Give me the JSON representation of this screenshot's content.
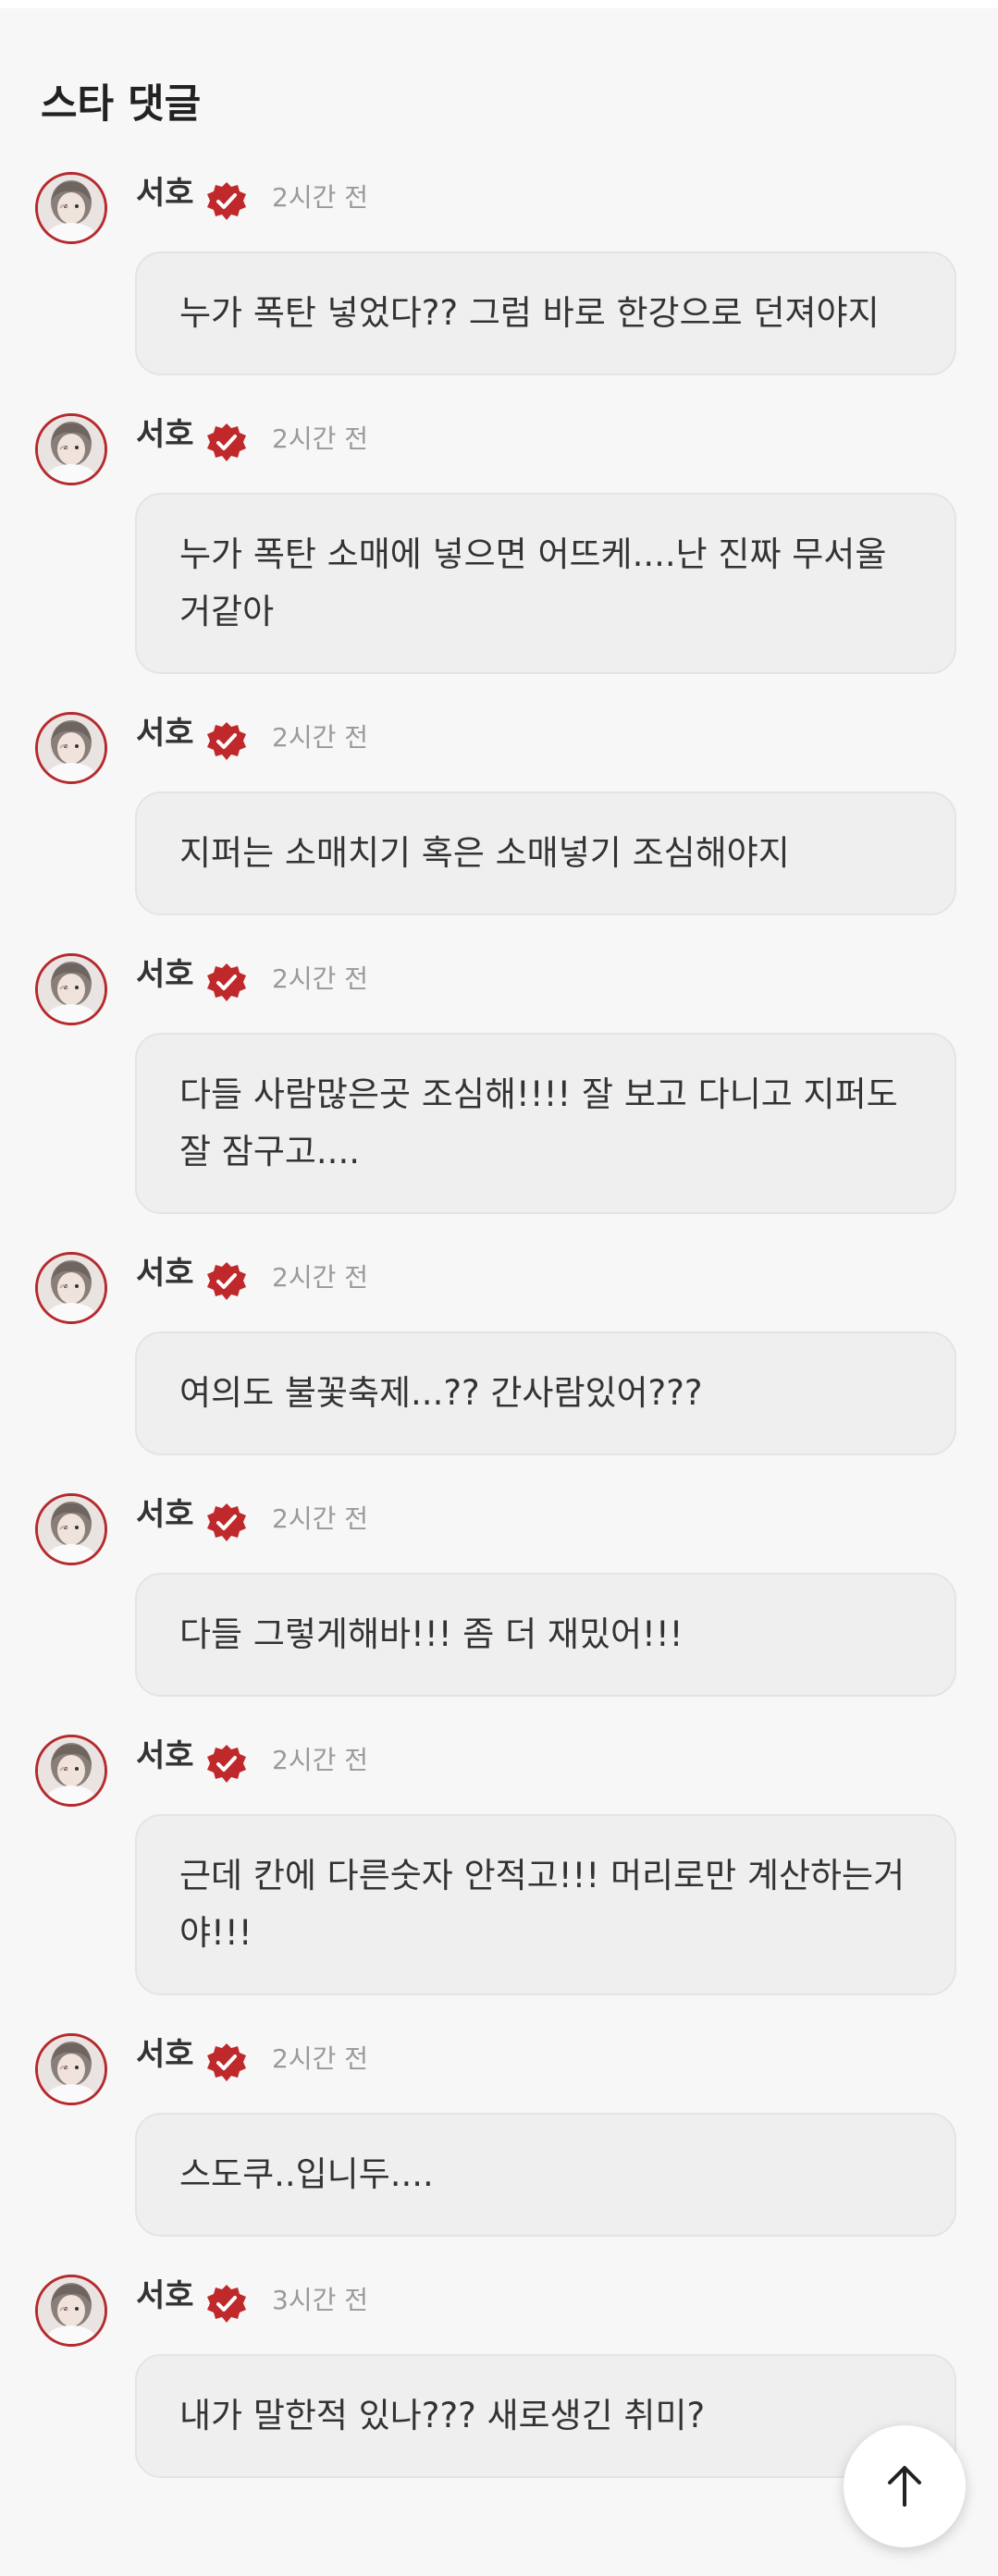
{
  "section_title": "스타 댓글",
  "comments": [
    {
      "author": "서호",
      "time": "2시간 전",
      "text": "누가 폭탄 넣었다?? 그럼 바로 한강으로 던져야지"
    },
    {
      "author": "서호",
      "time": "2시간 전",
      "text": "누가 폭탄 소매에 넣으면 어뜨케....난 진짜 무서울거같아"
    },
    {
      "author": "서호",
      "time": "2시간 전",
      "text": "지퍼는 소매치기 혹은 소매넣기 조심해야지"
    },
    {
      "author": "서호",
      "time": "2시간 전",
      "text": "다들 사람많은곳 조심해!!!! 잘 보고 다니고 지퍼도 잘 잠구고...."
    },
    {
      "author": "서호",
      "time": "2시간 전",
      "text": "여의도 불꽃축제...?? 간사람있어???"
    },
    {
      "author": "서호",
      "time": "2시간 전",
      "text": "다들 그렇게해바!!! 좀 더 재밌어!!!"
    },
    {
      "author": "서호",
      "time": "2시간 전",
      "text": "근데 칸에 다른숫자 안적고!!! 머리로만 계산하는거야!!!"
    },
    {
      "author": "서호",
      "time": "2시간 전",
      "text": "스도쿠..입니두...."
    },
    {
      "author": "서호",
      "time": "3시간 전",
      "text": "내가 말한적 있나??? 새로생긴 취미?"
    }
  ],
  "colors": {
    "verified_badge": "#c0292b",
    "avatar_ring": "#b52a2d",
    "bubble_bg": "#efefef",
    "page_bg": "#f7f7f7"
  },
  "icons": {
    "verified": "verified-badge-icon",
    "scroll_top": "arrow-up-icon"
  }
}
